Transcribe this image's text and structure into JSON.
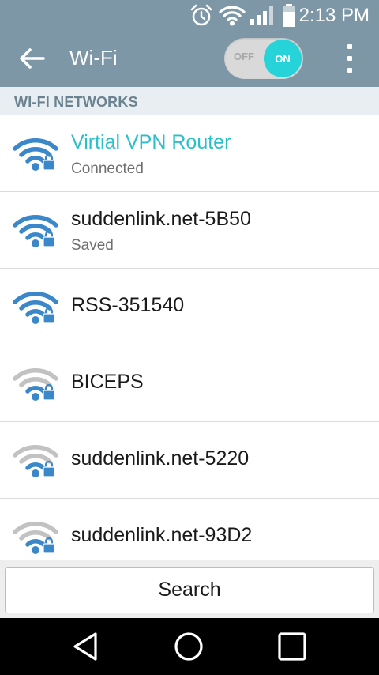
{
  "status_bar": {
    "time": "2:13 PM",
    "icons": [
      "alarm-icon",
      "wifi-signal-icon",
      "cell-signal-icon",
      "battery-icon"
    ]
  },
  "app_bar": {
    "title": "Wi-Fi",
    "back_icon": "arrow-left-icon",
    "toggle": {
      "off_label": "OFF",
      "on_label": "ON",
      "state": "on"
    },
    "overflow_icon": "more-vert-icon"
  },
  "section": {
    "header": "WI-FI NETWORKS"
  },
  "networks": [
    {
      "name": "Virtial VPN Router",
      "status": "Connected",
      "signal": "strong",
      "secured": true,
      "connected": true
    },
    {
      "name": "suddenlink.net-5B50",
      "status": "Saved",
      "signal": "strong",
      "secured": true,
      "connected": false
    },
    {
      "name": "RSS-351540",
      "status": "",
      "signal": "strong",
      "secured": true,
      "connected": false
    },
    {
      "name": "BICEPS",
      "status": "",
      "signal": "weak",
      "secured": true,
      "connected": false
    },
    {
      "name": "suddenlink.net-5220",
      "status": "",
      "signal": "weak",
      "secured": true,
      "connected": false
    },
    {
      "name": "suddenlink.net-93D2",
      "status": "",
      "signal": "weak",
      "secured": true,
      "connected": false
    }
  ],
  "search": {
    "label": "Search"
  },
  "nav_bar": {
    "icons": [
      "back-triangle-icon",
      "home-circle-icon",
      "recents-square-icon"
    ]
  },
  "colors": {
    "app_bar": "#7e97a6",
    "accent": "#26d3d9",
    "connected_text": "#2bbfc9",
    "signal_strong": "#3a87c9",
    "signal_weak": "#c2c2c2",
    "lock": "#3a87c9"
  }
}
